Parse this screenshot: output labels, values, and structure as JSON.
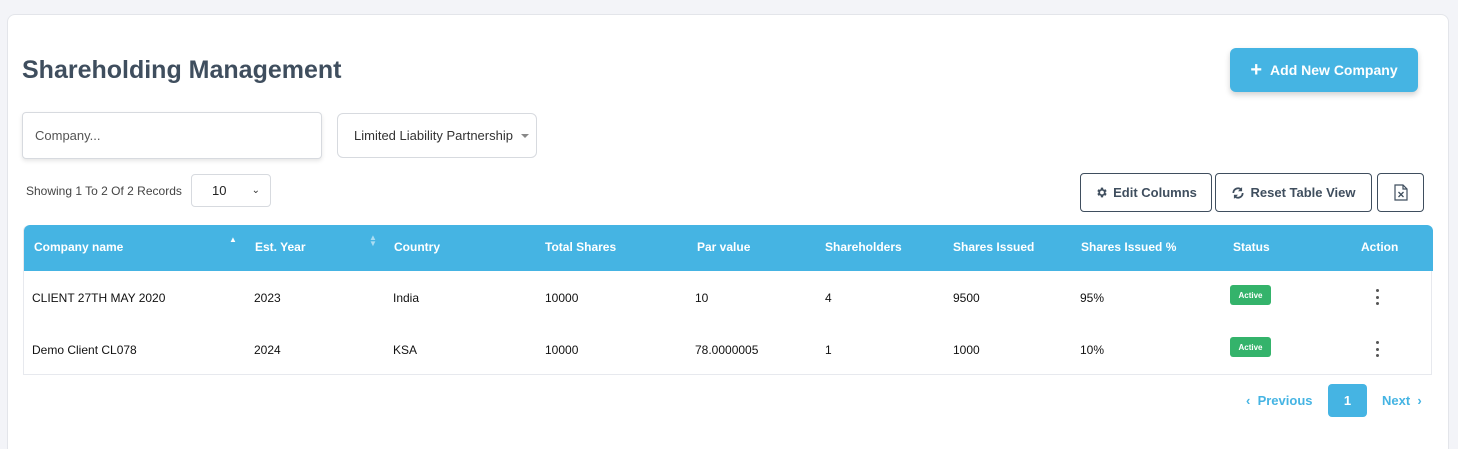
{
  "header": {
    "title": "Shareholding Management",
    "add_button_label": "Add New Company"
  },
  "filters": {
    "company_placeholder": "Company...",
    "company_type_selected": "Limited Liability Partnership"
  },
  "records": {
    "info": "Showing 1 To 2 Of 2 Records",
    "page_size": "10"
  },
  "toolbar": {
    "edit_columns_label": "Edit Columns",
    "reset_view_label": "Reset Table View",
    "export_icon": "excel-export-icon"
  },
  "table": {
    "columns": [
      "Company name",
      "Est. Year",
      "Country",
      "Total Shares",
      "Par value",
      "Shareholders",
      "Shares Issued",
      "Shares Issued %",
      "Status",
      "Action"
    ],
    "rows": [
      {
        "company": "CLIENT 27TH MAY 2020",
        "year": "2023",
        "country": "India",
        "total_shares": "10000",
        "par_value": "10",
        "shareholders": "4",
        "shares_issued": "9500",
        "issued_pct": "95%",
        "status": "Active"
      },
      {
        "company": "Demo Client CL078",
        "year": "2024",
        "country": "KSA",
        "total_shares": "10000",
        "par_value": "78.0000005",
        "shareholders": "1",
        "shares_issued": "1000",
        "issued_pct": "10%",
        "status": "Active"
      }
    ]
  },
  "pagination": {
    "previous": "Previous",
    "current": "1",
    "next": "Next"
  },
  "colors": {
    "accent": "#45b4e3",
    "status_active": "#34b36b",
    "title_text": "#3f4e5e"
  }
}
